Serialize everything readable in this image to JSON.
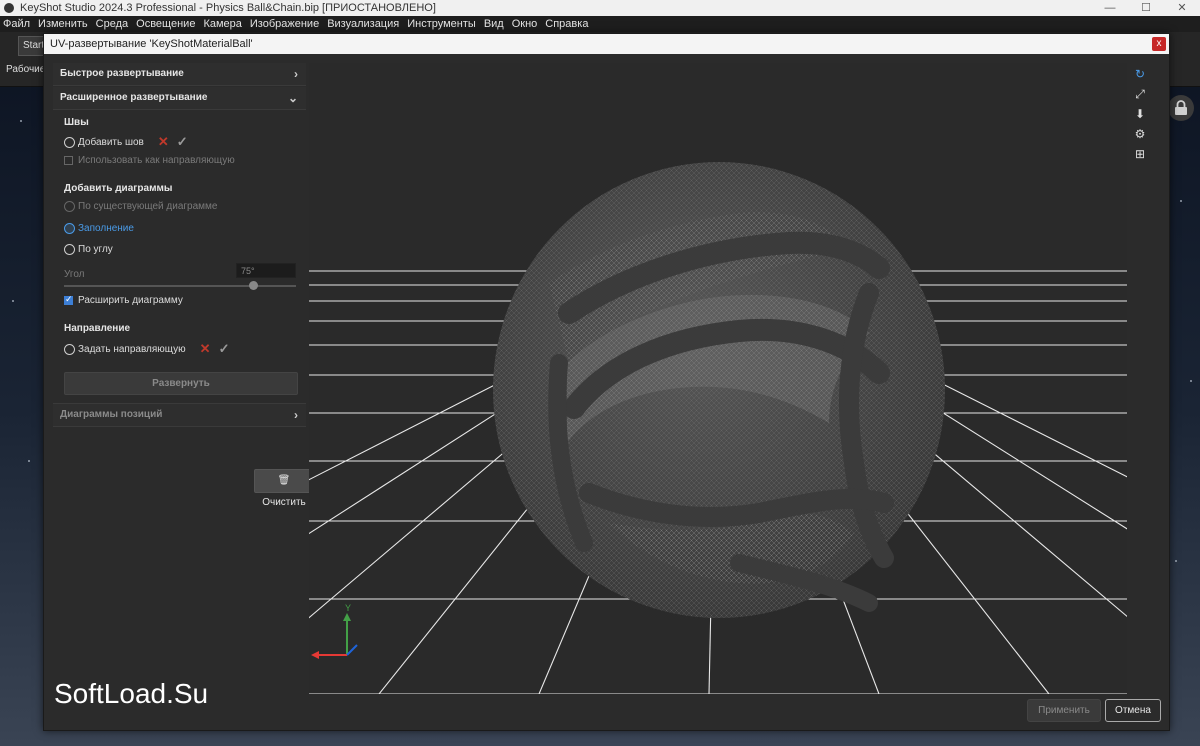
{
  "app": {
    "title": "KeyShot Studio 2024.3 Professional  - Physics Ball&Chain.bip [ПРИОСТАНОВЛЕНО]",
    "menu": [
      "Файл",
      "Изменить",
      "Среда",
      "Освещение",
      "Камера",
      "Изображение",
      "Визуализация",
      "Инструменты",
      "Вид",
      "Окно",
      "Справка"
    ],
    "start_tab": "Startu",
    "workspaces_label": "Рабочие"
  },
  "dialog": {
    "title": "UV-развертывание 'KeyShotMaterialBall'",
    "close": "x",
    "sections": {
      "quick": "Быстрое развертывание",
      "advanced": "Расширенное развертывание",
      "positions": "Диаграммы позиций"
    },
    "seams": {
      "title": "Швы",
      "add_seam": "Добавить шов",
      "use_as_guide": "Использовать как направляющую"
    },
    "add_charts": {
      "title": "Добавить диаграммы",
      "by_existing": "По существующей диаграмме",
      "fill": "Заполнение",
      "by_angle": "По углу",
      "angle_label": "Угол",
      "angle_value": "75°",
      "angle_fraction": 0.83,
      "expand_chart": "Расширить диаграмму"
    },
    "direction": {
      "title": "Направление",
      "set_guide": "Задать направляющую"
    },
    "unwrap_button": "Развернуть",
    "clear_button": "Очистить",
    "apply_button": "Применить",
    "cancel_button": "Отмена"
  },
  "colors": {
    "accent": "#4a9be8",
    "delete_red": "#c0392b",
    "axis_x": "#e53935",
    "axis_y": "#43a047",
    "axis_z": "#1e63d8"
  },
  "gizmo": {
    "y_label": "Y"
  },
  "watermark": "SoftLoad.Su"
}
